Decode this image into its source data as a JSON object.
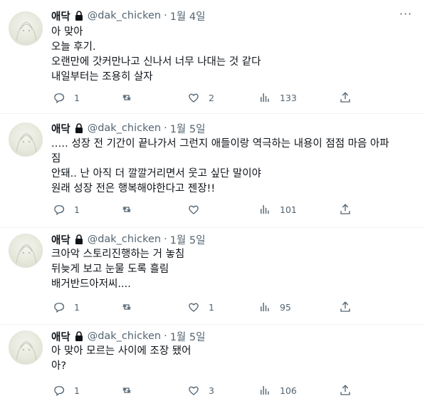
{
  "author": {
    "name": "애닥",
    "handle": "@dak_chicken",
    "separator": "·"
  },
  "tweets": [
    {
      "date": "1월 4일",
      "lines": [
        "아 맞아",
        "오늘 후기.",
        "오랜만에 갓커만나고 신나서 너무 나대는 것 같다",
        "내일부터는 조용히 살자"
      ],
      "replies": "1",
      "retweets": "",
      "likes": "2",
      "views": "133"
    },
    {
      "date": "1월 5일",
      "lines": [
        ".…. 성장 전 기간이 끝나가서 그런지 애들이랑 역극하는 내용이 점점 마음 아파",
        "짐",
        "안돼.. 난 아직 더 깔깔거리면서 웃고 싶단 말이야",
        "원래 성장 전은 행복해야한다고 젠장!!"
      ],
      "replies": "1",
      "retweets": "",
      "likes": "",
      "views": "101"
    },
    {
      "date": "1월 5일",
      "lines": [
        "크아악 스토리진행하는 거 놓침",
        "뒤늦게 보고 눈물 도록 흘림",
        "배거반드아저씨...."
      ],
      "replies": "1",
      "retweets": "",
      "likes": "1",
      "views": "95"
    },
    {
      "date": "1월 5일",
      "lines": [
        "아 맞아 모르는 사이에 조장 됐어",
        "아?"
      ],
      "replies": "1",
      "retweets": "",
      "likes": "3",
      "views": "106"
    }
  ],
  "icons": {
    "lock": "lock-icon",
    "more": "more-icon",
    "reply": "reply-icon",
    "retweet": "retweet-icon",
    "like": "heart-icon",
    "views": "views-icon",
    "share": "share-icon"
  },
  "colors": {
    "text": "#0f1419",
    "secondary": "#536471",
    "divider": "#eff3f4"
  }
}
